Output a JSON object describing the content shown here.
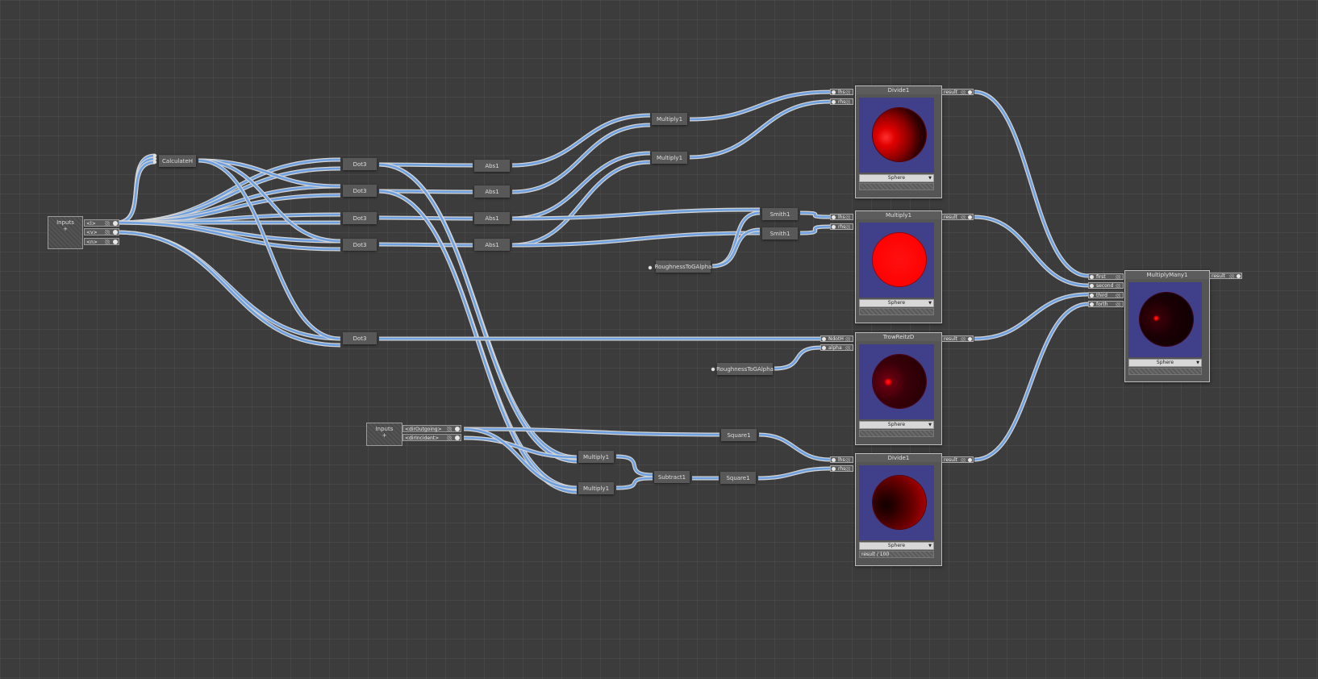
{
  "inputs_a": {
    "title": "Inputs",
    "glyph": "+",
    "rows": [
      "<l>",
      "<v>",
      "<n>"
    ]
  },
  "inputs_b": {
    "title": "Inputs",
    "glyph": "+",
    "rows": [
      "<dirOutgoing>",
      "<dirIncident>"
    ]
  },
  "nodes": {
    "calcH": "CalculateH",
    "dot": "Dot3",
    "abs": "Abs1",
    "multiply": "Multiply1",
    "smith": "Smith1",
    "rough1": "RoughnessToGAlpha",
    "rough2": "RoughnessToGAlpha",
    "square": "Square1",
    "subtract": "Subtract1"
  },
  "previews": {
    "divide_top": {
      "title": "Divide1",
      "inputs": [
        "lhs",
        "rhs"
      ],
      "output": "result",
      "select": "Sphere",
      "bar": ""
    },
    "multiply": {
      "title": "Multiply1",
      "inputs": [
        "lhs",
        "rhs"
      ],
      "output": "result",
      "select": "Sphere",
      "bar": ""
    },
    "trowbridge": {
      "title": "TrowReitzD",
      "inputs": [
        "NdotH",
        "alpha"
      ],
      "output": "result",
      "select": "Sphere",
      "bar": ""
    },
    "divide_bottom": {
      "title": "Divide1",
      "inputs": [
        "lhs",
        "rhs"
      ],
      "output": "result",
      "select": "Sphere",
      "bar": "result / 100"
    },
    "multiplymany": {
      "title": "MultiplyMany1",
      "inputs": [
        "first",
        "second",
        "third",
        "forth"
      ],
      "output": "result",
      "select": "Sphere",
      "bar": ""
    }
  },
  "colors": {
    "wire": "#6fa1e0",
    "background": "#3c3c3c",
    "preview_bg": "#3f3f8a",
    "sphere_red": "#ff0000"
  }
}
